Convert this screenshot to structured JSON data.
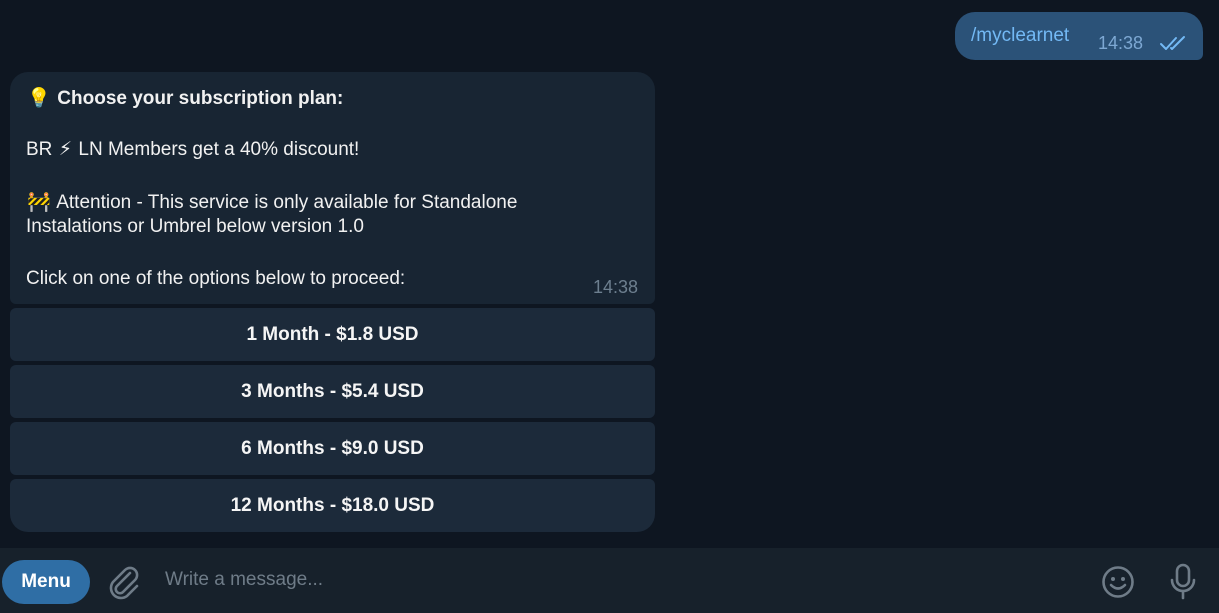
{
  "outgoing": {
    "text": "/myclearnet",
    "time": "14:38",
    "status_icon": "double-check-icon"
  },
  "incoming": {
    "title_emoji": "💡",
    "title": "Choose your subscription plan:",
    "discount_prefix": "BR",
    "discount_emoji": "⚡",
    "discount_text": "LN Members get a 40% discount!",
    "attention_emoji": "🚧",
    "attention_line1": "Attention - This service is only available for Standalone",
    "attention_line2": "Instalations or Umbrel below version 1.0",
    "instructions": "Click on one of the options below to proceed:",
    "time": "14:38"
  },
  "buttons": [
    {
      "label": "1 Month - $1.8 USD"
    },
    {
      "label": "3 Months - $5.4 USD"
    },
    {
      "label": "6 Months - $9.0 USD"
    },
    {
      "label": "12 Months - $18.0 USD"
    }
  ],
  "composer": {
    "menu_label": "Menu",
    "placeholder": "Write a message...",
    "icons": [
      "paperclip-icon",
      "smiley-icon",
      "microphone-icon"
    ]
  },
  "colors": {
    "background": "#0e1621",
    "outgoing_bubble": "#2b5278",
    "incoming_bubble": "#182533",
    "menu_button": "#2f6ea5"
  }
}
